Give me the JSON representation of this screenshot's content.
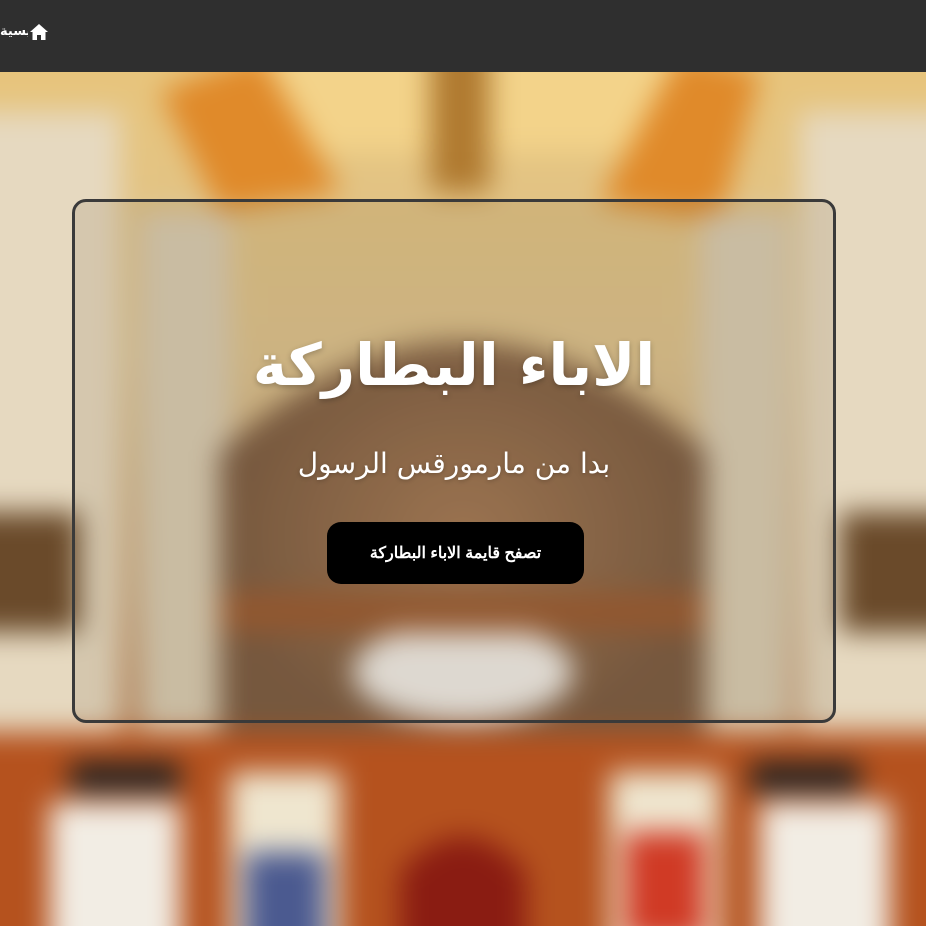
{
  "navbar": {
    "home_label": "الصفحة الرئيسية",
    "home_icon": "home-icon"
  },
  "hero": {
    "title": "الاباء البطاركة",
    "subtitle": "بدا من مارمورقس الرسول",
    "cta_label": "تصفح قايمة الاباء البطاركة"
  },
  "colors": {
    "navbar_bg": "#2f2f2f",
    "button_bg": "#000000",
    "card_border": "#3a3a3a",
    "text": "#ffffff"
  }
}
